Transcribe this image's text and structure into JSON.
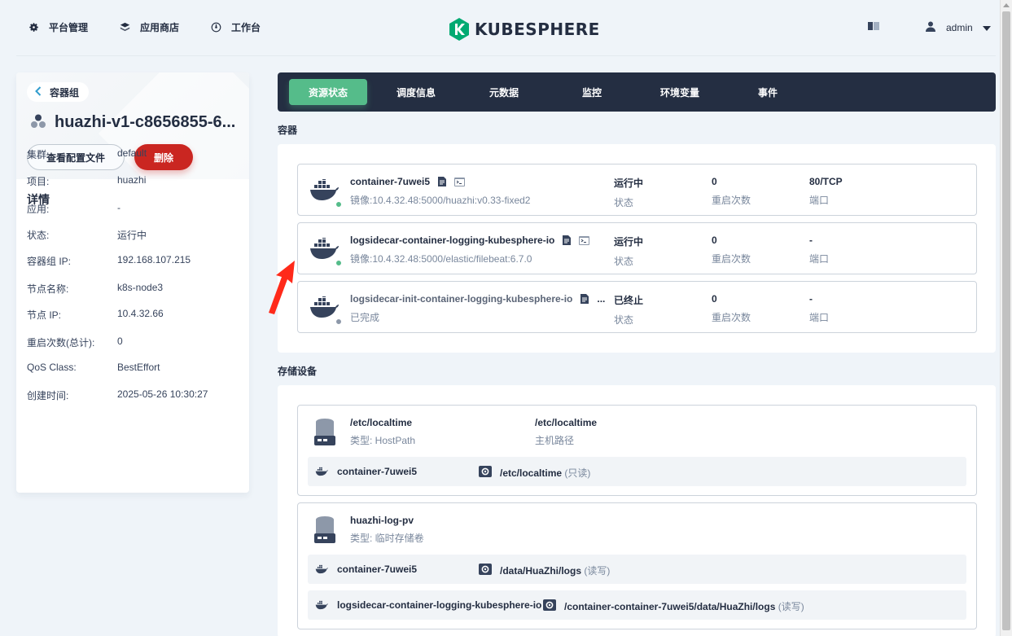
{
  "nav": {
    "platform": "平台管理",
    "appstore": "应用商店",
    "workbench": "工作台",
    "logo": "KUBESPHERE",
    "user": "admin"
  },
  "pod": {
    "back_label": "容器组",
    "name": "huazhi-v1-c8656855-6...",
    "view_config": "查看配置文件",
    "delete": "删除",
    "details_title": "详情",
    "details": [
      {
        "k": "集群:",
        "v": "default"
      },
      {
        "k": "项目:",
        "v": "huazhi"
      },
      {
        "k": "应用:",
        "v": "-"
      },
      {
        "k": "状态:",
        "v": "运行中"
      },
      {
        "k": "容器组 IP:",
        "v": "192.168.107.215"
      },
      {
        "k": "节点名称:",
        "v": "k8s-node3"
      },
      {
        "k": "节点 IP:",
        "v": "10.4.32.66"
      },
      {
        "k": "重启次数(总计):",
        "v": "0"
      },
      {
        "k": "QoS Class:",
        "v": "BestEffort"
      },
      {
        "k": "创建时间:",
        "v": "2025-05-26 10:30:27"
      }
    ]
  },
  "tabs": [
    "资源状态",
    "调度信息",
    "元数据",
    "监控",
    "环境变量",
    "事件"
  ],
  "containers_label": "容器",
  "containers": [
    {
      "name": "container-7uwei5",
      "sub": "镜像:10.4.32.48:5000/huazhi:v0.33-fixed2",
      "status": "运行中",
      "status_label": "状态",
      "restarts": "0",
      "restarts_label": "重启次数",
      "port": "80/TCP",
      "port_label": "端口",
      "dot": "#55bc8a",
      "more": ""
    },
    {
      "name": "logsidecar-container-logging-kubesphere-io",
      "sub": "镜像:10.4.32.48:5000/elastic/filebeat:6.7.0",
      "status": "运行中",
      "status_label": "状态",
      "restarts": "0",
      "restarts_label": "重启次数",
      "port": "-",
      "port_label": "端口",
      "dot": "#55bc8a",
      "more": ""
    },
    {
      "name": "logsidecar-init-container-logging-kubesphere-io",
      "sub": "已完成",
      "status": "已终止",
      "status_label": "状态",
      "restarts": "0",
      "restarts_label": "重启次数",
      "port": "-",
      "port_label": "端口",
      "dot": "#8d98a9",
      "more": "..."
    }
  ],
  "storage_label": "存储设备",
  "volumes": [
    {
      "name": "/etc/localtime",
      "type": "类型: HostPath",
      "path": "/etc/localtime",
      "path_label": "主机路径",
      "mounts": [
        {
          "container": "container-7uwei5",
          "path": "/etc/localtime",
          "mode": "(只读)"
        }
      ]
    },
    {
      "name": "huazhi-log-pv",
      "type": "类型: 临时存储卷",
      "mounts": [
        {
          "container": "container-7uwei5",
          "path": "/data/HuaZhi/logs",
          "mode": "(读写)"
        },
        {
          "container": "logsidecar-container-logging-kubesphere-io",
          "path": "/container-container-7uwei5/data/HuaZhi/logs",
          "mode": "(读写)"
        }
      ]
    }
  ]
}
